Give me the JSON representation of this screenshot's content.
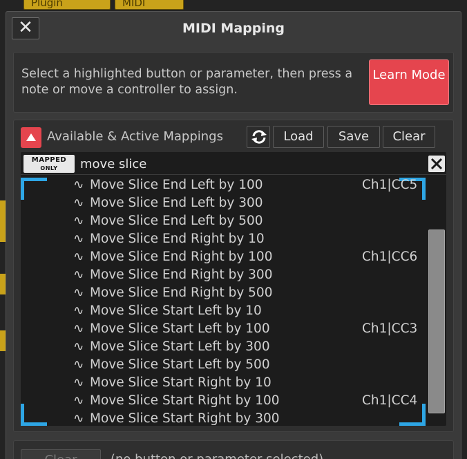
{
  "background": {
    "tabs": [
      {
        "label": "Plugin"
      },
      {
        "label": "MIDI"
      }
    ]
  },
  "dialog": {
    "title": "MIDI Mapping",
    "close_label": "✕"
  },
  "info": {
    "text": "Select a highlighted button or parameter, then press a note or move a controller to assign.",
    "learn_button": "Learn Mode"
  },
  "mappings": {
    "section_label": "Available & Active Mappings",
    "refresh_icon": "refresh-icon",
    "load_label": "Load",
    "save_label": "Save",
    "clear_label": "Clear",
    "mapped_only_line1": "MAPPED",
    "mapped_only_line2": "ONLY",
    "search_value": "move slice",
    "items": [
      {
        "name": "Move Slice End Left by 100",
        "mapping": "Ch1|CC5"
      },
      {
        "name": "Move Slice End Left by 300",
        "mapping": ""
      },
      {
        "name": "Move Slice End Left by 500",
        "mapping": ""
      },
      {
        "name": "Move Slice End Right by 10",
        "mapping": ""
      },
      {
        "name": "Move Slice End Right by 100",
        "mapping": "Ch1|CC6"
      },
      {
        "name": "Move Slice End Right by 300",
        "mapping": ""
      },
      {
        "name": "Move Slice End Right by 500",
        "mapping": ""
      },
      {
        "name": "Move Slice Start Left by 10",
        "mapping": ""
      },
      {
        "name": "Move Slice Start Left by 100",
        "mapping": "Ch1|CC3"
      },
      {
        "name": "Move Slice Start Left by 300",
        "mapping": ""
      },
      {
        "name": "Move Slice Start Left by 500",
        "mapping": ""
      },
      {
        "name": "Move Slice Start Right by 10",
        "mapping": ""
      },
      {
        "name": "Move Slice Start Right by 100",
        "mapping": "Ch1|CC4"
      },
      {
        "name": "Move Slice Start Right by 300",
        "mapping": ""
      }
    ],
    "item_prefix": "∿"
  },
  "bottom": {
    "clear_label": "Clear",
    "status": "(no button or parameter selected)"
  },
  "colors": {
    "accent_red": "#e5454e",
    "corner_blue": "#2ea6e5",
    "plugin_yellow": "#c9a21a"
  }
}
